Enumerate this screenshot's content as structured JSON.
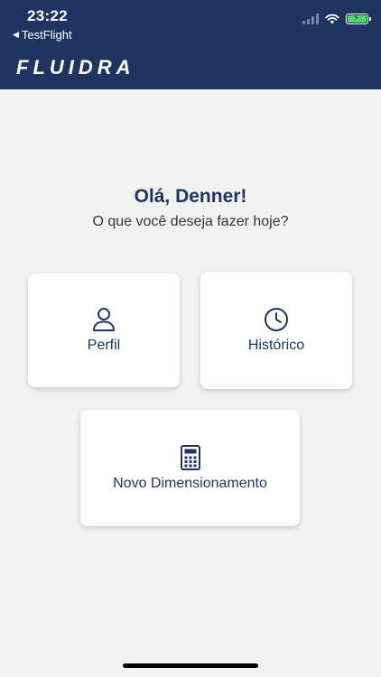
{
  "status_bar": {
    "time": "23:22",
    "back_app": "TestFlight",
    "back_icon": "triangle-left-icon"
  },
  "header": {
    "logo_text": "FLUIDRA",
    "background_color": "#1f3460"
  },
  "main": {
    "greeting": "Olá, Denner!",
    "subtitle": "O que você deseja fazer hoje?",
    "cards": [
      {
        "label": "Perfil",
        "icon": "user-icon"
      },
      {
        "label": "Histórico",
        "icon": "clock-icon"
      },
      {
        "label": "Novo Dimensionamento",
        "icon": "calculator-icon"
      }
    ]
  },
  "colors": {
    "primary": "#1f3460",
    "background": "#f2f2f2",
    "card": "#ffffff",
    "battery": "#4cd964"
  }
}
